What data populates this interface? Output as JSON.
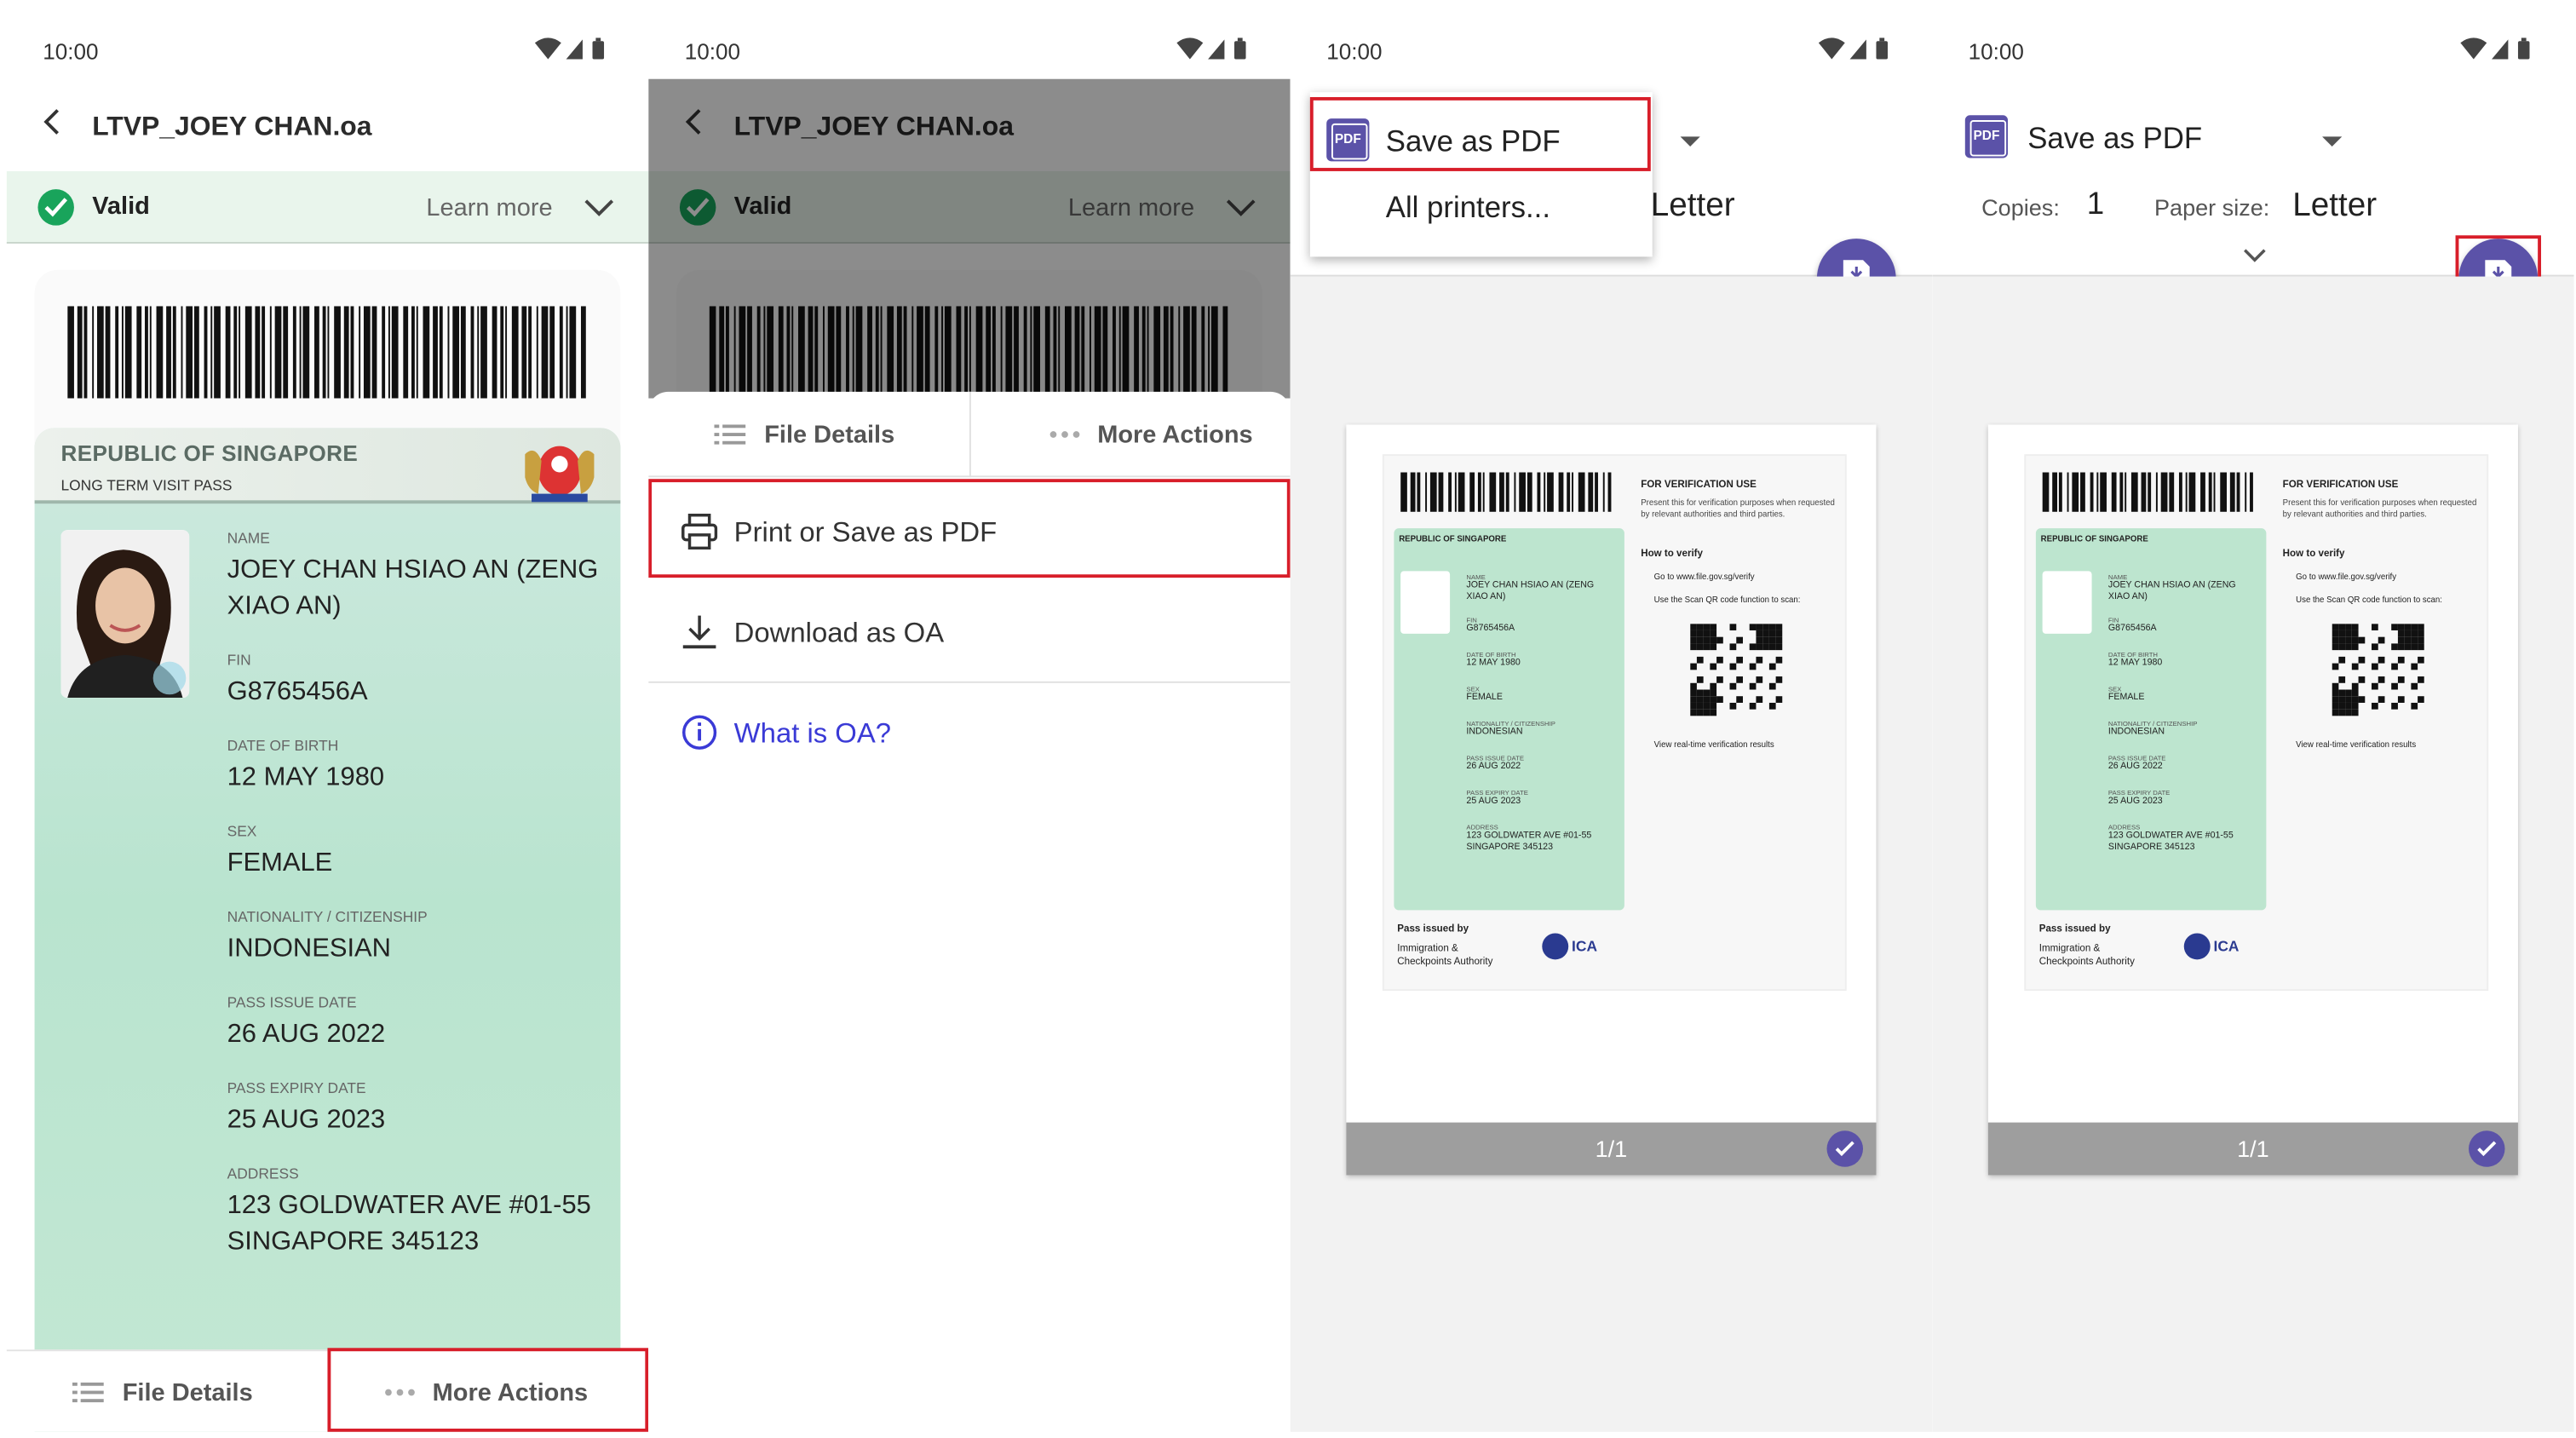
{
  "status_time": "10:00",
  "app_title": "LTVP_JOEY CHAN.oa",
  "valid_label": "Valid",
  "learn_more": "Learn more",
  "card": {
    "country": "REPUBLIC OF SINGAPORE",
    "pass_type": "LONG TERM VISIT PASS",
    "fields": [
      {
        "label": "NAME",
        "value": "JOEY CHAN HSIAO AN (ZENG XIAO AN)"
      },
      {
        "label": "FIN",
        "value": "G8765456A"
      },
      {
        "label": "DATE OF BIRTH",
        "value": "12 MAY 1980"
      },
      {
        "label": "SEX",
        "value": "FEMALE"
      },
      {
        "label": "NATIONALITY / CITIZENSHIP",
        "value": "INDONESIAN"
      },
      {
        "label": "PASS ISSUE DATE",
        "value": "26 AUG 2022"
      },
      {
        "label": "PASS EXPIRY DATE",
        "value": "25 AUG 2023"
      },
      {
        "label": "ADDRESS",
        "value": "123 GOLDWATER AVE #01-55 SINGAPORE 345123"
      }
    ]
  },
  "tabs": {
    "file_details": "File Details",
    "more_actions": "More Actions"
  },
  "menu": {
    "print": "Print or Save as PDF",
    "download": "Download as OA",
    "what_is_oa": "What is OA?"
  },
  "print_dialog": {
    "destination": "Save as PDF",
    "all_printers": "All printers...",
    "copies_label": "Copies:",
    "copies_value": "1",
    "paper_label": "Paper size:",
    "paper_value": "Letter",
    "page_counter": "1/1",
    "pdf_icon_text": "PDF"
  },
  "preview": {
    "verification_title": "FOR VERIFICATION USE",
    "verification_text": "Present this for verification purposes when requested by relevant authorities and third parties.",
    "how_to_verify": "How to verify",
    "step1": "Go to www.file.gov.sg/verify",
    "step2": "Use the Scan QR code function to scan:",
    "step3": "View real-time verification results",
    "issued_by": "Pass issued by",
    "authority": "Immigration & Checkpoints Authority",
    "ica": "ICA"
  },
  "icons": [
    "back-arrow-icon",
    "wifi-icon",
    "signal-icon",
    "battery-icon",
    "check-icon",
    "chevron-down-icon",
    "list-icon",
    "more-dots-icon",
    "printer-icon",
    "download-icon",
    "info-icon",
    "pdf-icon",
    "save-pdf-icon"
  ],
  "colors": {
    "accent": "#5b52a8",
    "valid_green": "#19a45b",
    "highlight_red": "#d81e2a",
    "link_blue": "#3a3ad6"
  }
}
